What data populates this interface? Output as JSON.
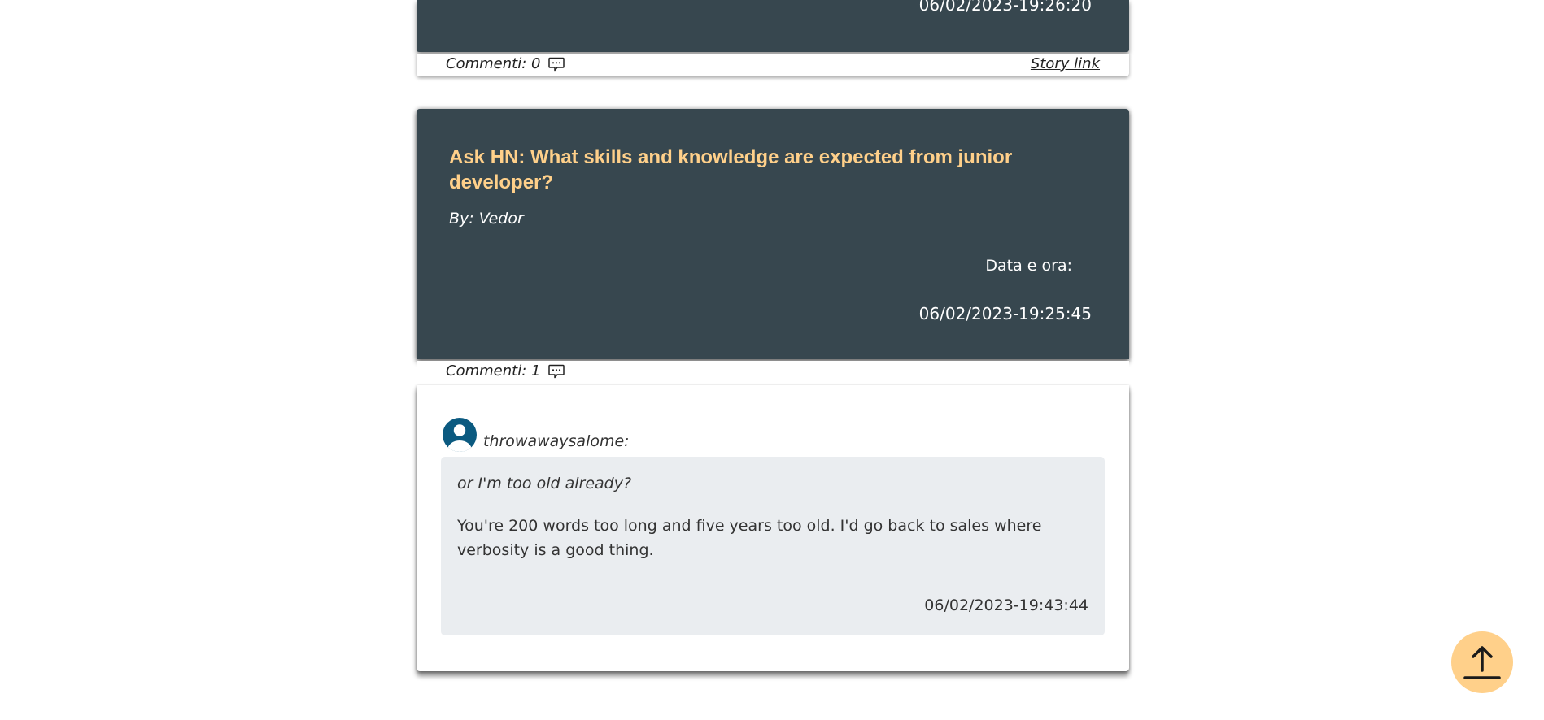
{
  "stories": [
    {
      "date_value": "06/02/2023-19:26:20",
      "comments_label": "Commenti: 0",
      "story_link_label": "Story link"
    },
    {
      "title": "Ask HN: What skills and knowledge are expected from junior developer?",
      "author": "By: Vedor",
      "date_label": "Data e ora:",
      "date_value": "06/02/2023-19:25:45",
      "comments_label": "Commenti: 1",
      "comments": [
        {
          "author": "throwawaysalome:",
          "quote": "or I'm too old already?",
          "body": "You're 200 words too long and five years too old. I'd go back to sales where verbosity is a good thing.",
          "date": "06/02/2023-19:43:44"
        }
      ]
    }
  ],
  "colors": {
    "card_background": "#37474f",
    "title_accent": "#ffd08a",
    "comment_background": "#eaedf0",
    "avatar": "#0b5a80",
    "fab_background": "#ffd08a"
  },
  "icons": {
    "comments": "chat-bubble-icon",
    "avatar": "user-circle-icon",
    "scroll_top": "arrow-up-to-line-icon"
  }
}
